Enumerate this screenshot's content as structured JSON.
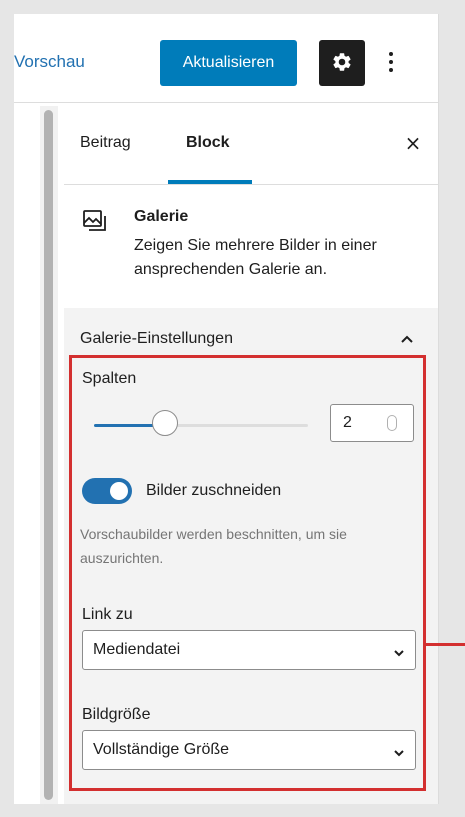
{
  "toolbar": {
    "preview_label": "Vorschau",
    "update_label": "Aktualisieren",
    "settings_icon": "gear-icon",
    "more_icon": "vertical-ellipsis-icon"
  },
  "sidebar": {
    "tabs": [
      {
        "label": "Beitrag",
        "active": false
      },
      {
        "label": "Block",
        "active": true
      }
    ],
    "close_label": "×"
  },
  "block": {
    "icon": "gallery-icon",
    "title": "Galerie",
    "description": "Zeigen Sie mehrere Bilder in einer ansprechenden Galerie an."
  },
  "panel": {
    "title": "Galerie-Einstellungen",
    "expanded": true,
    "columns": {
      "label": "Spalten",
      "value": "2"
    },
    "crop": {
      "label": "Bilder zuschneiden",
      "enabled": true,
      "help": "Vorschaubilder werden beschnitten, um sie auszurichten."
    },
    "link_to": {
      "label": "Link zu",
      "selected": "Mediendatei"
    },
    "image_size": {
      "label": "Bildgröße",
      "selected": "Vollständige Größe"
    }
  },
  "colors": {
    "accent": "#007cba",
    "annotation": "#d32f2f"
  }
}
